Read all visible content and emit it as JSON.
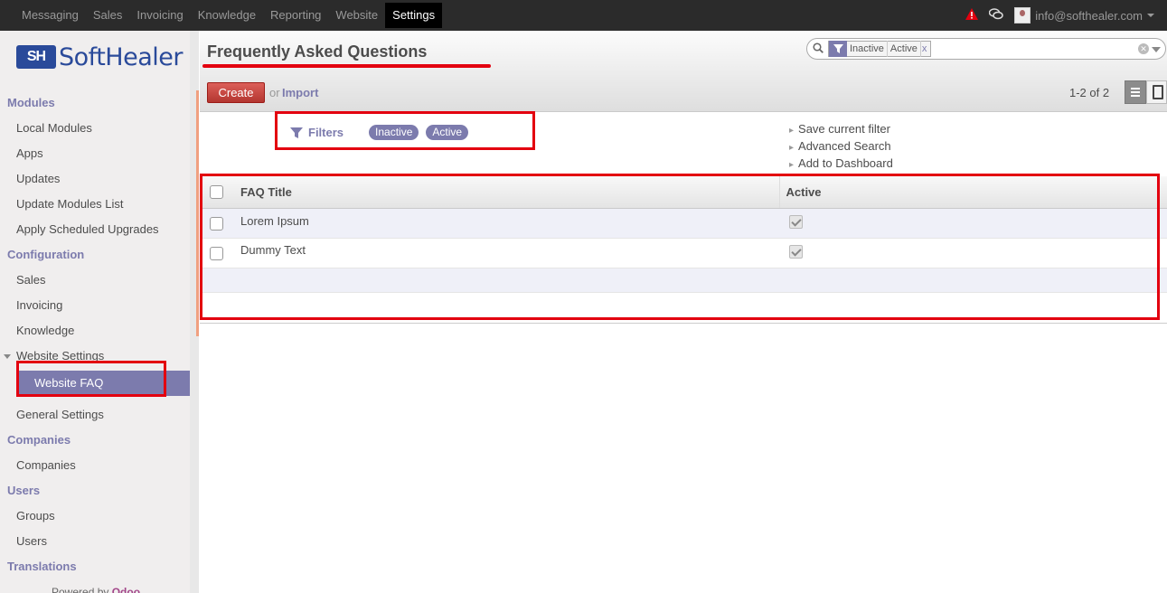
{
  "topbar": {
    "menu": [
      "Messaging",
      "Sales",
      "Invoicing",
      "Knowledge",
      "Reporting",
      "Website",
      "Settings"
    ],
    "active_menu": "Settings",
    "user_email": "info@softhealer.com",
    "alert_icon": "warning-triangle-icon",
    "chat_icon": "chat-bubbles-icon"
  },
  "brand": {
    "mark": "SH",
    "name": "SoftHealer",
    "color": "#2a4a9a"
  },
  "sidebar": {
    "sections": [
      {
        "title": "Modules",
        "items": [
          "Local Modules",
          "Apps",
          "Updates",
          "Update Modules List",
          "Apply Scheduled Upgrades"
        ]
      },
      {
        "title": "Configuration",
        "items": [
          "Sales",
          "Invoicing",
          "Knowledge",
          "Website Settings",
          "Website FAQ",
          "General Settings"
        ]
      },
      {
        "title": "Companies",
        "items": [
          "Companies"
        ]
      },
      {
        "title": "Users",
        "items": [
          "Groups",
          "Users"
        ]
      },
      {
        "title": "Translations",
        "items": []
      }
    ],
    "selected_item": "Website FAQ",
    "powered_by": "Powered by",
    "powered_brand": "Odoo"
  },
  "control": {
    "title": "Frequently Asked Questions",
    "create_label": "Create",
    "or_label": "or",
    "import_label": "Import",
    "pager": "1-2 of 2",
    "search_facets": [
      "Inactive",
      "Active"
    ],
    "facet_close": "x"
  },
  "drawer": {
    "filters_label": "Filters",
    "filter_pills": [
      "Inactive",
      "Active"
    ],
    "links": [
      "Save current filter",
      "Advanced Search",
      "Add to Dashboard"
    ]
  },
  "list": {
    "columns": [
      "FAQ Title",
      "Active"
    ],
    "rows": [
      {
        "title": "Lorem Ipsum",
        "active": true
      },
      {
        "title": "Dummy Text",
        "active": true
      }
    ]
  },
  "colors": {
    "accent": "#7c7bad",
    "create_button": "#c9302c",
    "annotation": "#e3000f",
    "topbar": "#2b2b2b"
  }
}
